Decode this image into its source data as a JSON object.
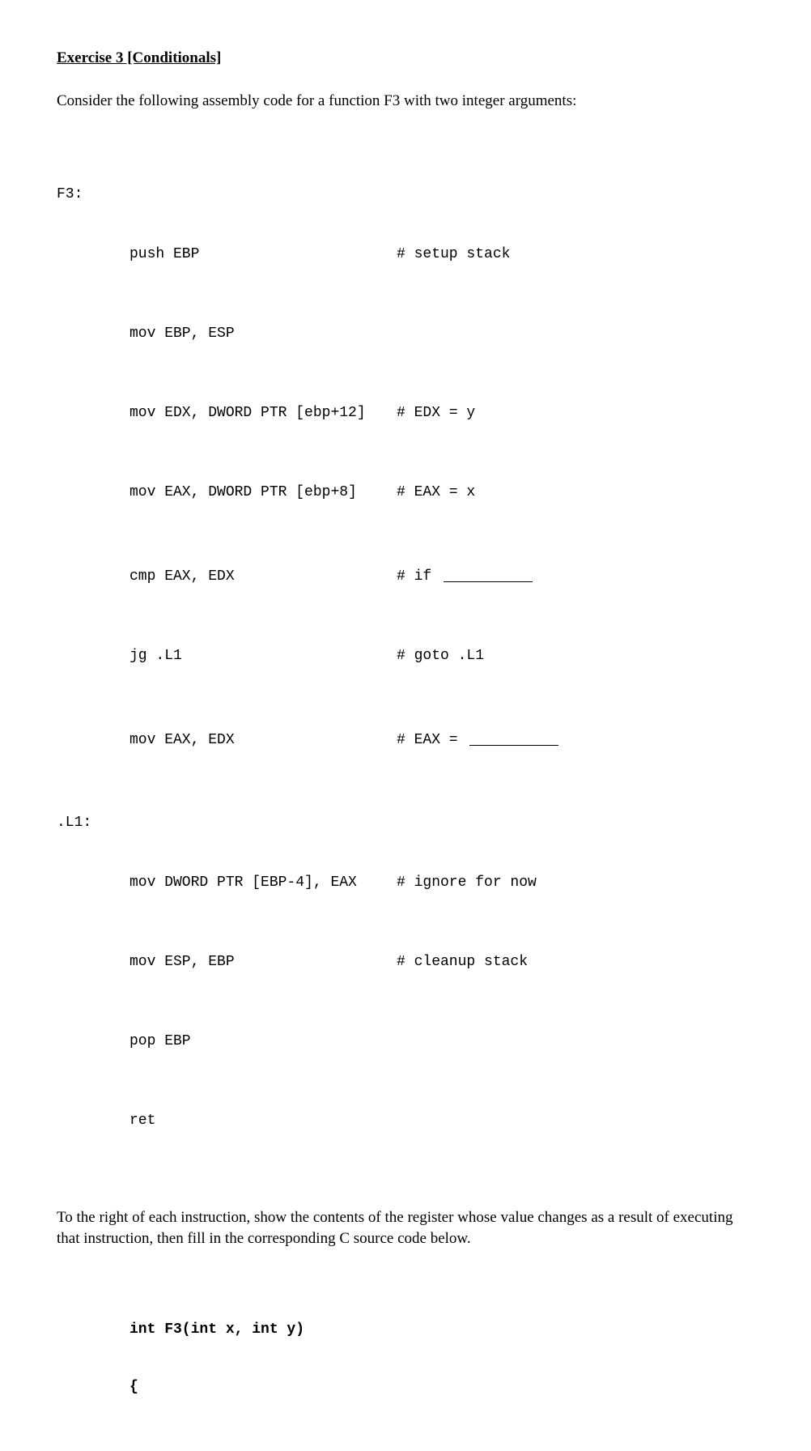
{
  "heading": "Exercise 3 [Conditionals]",
  "intro": "Consider the following assembly code for a function F3 with two integer arguments:",
  "asm": {
    "rows": [
      {
        "label": "F3:",
        "instr": "",
        "comment": ""
      },
      {
        "label": "",
        "instr": "push EBP",
        "comment": "# setup stack"
      },
      {
        "label": "",
        "instr": "mov EBP, ESP",
        "comment": ""
      },
      {
        "label": "",
        "instr": "mov EDX, DWORD PTR [ebp+12]",
        "comment": "# EDX = y"
      },
      {
        "label": "",
        "instr": "mov EAX, DWORD PTR [ebp+8]",
        "comment": "# EAX = x"
      },
      {
        "label": "",
        "instr": "cmp EAX, EDX",
        "comment_prefix": "# if ",
        "blank": true
      },
      {
        "label": "",
        "instr": "jg .L1",
        "comment": "# goto .L1"
      },
      {
        "label": "",
        "instr": "mov EAX, EDX",
        "comment_prefix": "# EAX = ",
        "blank": true
      },
      {
        "label": ".L1:",
        "instr": "",
        "comment": ""
      },
      {
        "label": "",
        "instr": "mov DWORD PTR [EBP-4], EAX",
        "comment": "# ignore for now"
      },
      {
        "label": "",
        "instr": "mov ESP, EBP",
        "comment": "# cleanup stack"
      },
      {
        "label": "",
        "instr": "pop EBP",
        "comment": ""
      },
      {
        "label": "",
        "instr": "ret",
        "comment": ""
      }
    ]
  },
  "outro": "To the right of each instruction, show the contents of the register whose value changes as a result of executing that instruction, then fill in the corresponding C source code below.",
  "csource_line1": "int F3(int x, int y)",
  "csource_line2": "{"
}
